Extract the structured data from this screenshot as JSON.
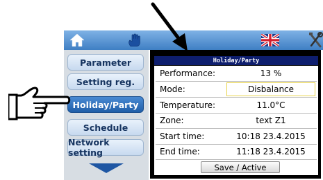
{
  "toolbar": {
    "icons": [
      "home-icon",
      "hand-touch-icon",
      "uk-flag-icon",
      "tools-icon"
    ]
  },
  "menu": {
    "items": [
      {
        "label": "Parameter"
      },
      {
        "label": "Setting reg."
      },
      {
        "label": "Holiday/Party",
        "active": true
      },
      {
        "label": "Schedule"
      },
      {
        "label": "Network setting"
      }
    ]
  },
  "dialog": {
    "title": "Holiday/Party",
    "rows": [
      {
        "label": "Performance:",
        "value": "13  %"
      },
      {
        "label": "Mode:",
        "value": "Disbalance"
      },
      {
        "label": "Temperature:",
        "value": "11.0°C"
      },
      {
        "label": "Zone:",
        "value": "text Z1"
      },
      {
        "label": "Start time:",
        "value": "10:18 23.4.2015"
      },
      {
        "label": "End time:",
        "value": "11:18 23.4.2015"
      }
    ],
    "save_label": "Save / Active"
  },
  "colors": {
    "topbar": "#3f7fc4",
    "active_item": "#1f5ea8",
    "dialog_header": "#0e1e6e",
    "selected_field_border": "#e8d44a"
  }
}
